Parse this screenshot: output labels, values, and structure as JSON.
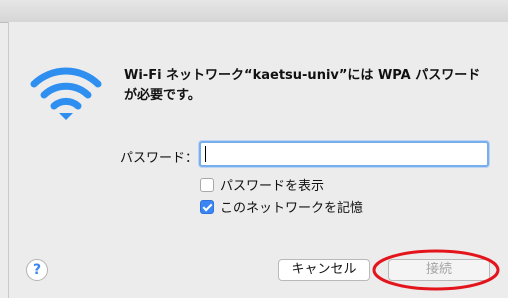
{
  "dialog": {
    "message": "Wi-Fi ネットワーク“kaetsu-univ”には WPA パスワードが必要です。",
    "password_label": "パスワード：",
    "password_value": "",
    "show_password_label": "パスワードを表示",
    "show_password_checked": false,
    "remember_label": "このネットワークを記憶",
    "remember_checked": true,
    "help_label": "?",
    "cancel_label": "キャンセル",
    "connect_label": "接続"
  },
  "colors": {
    "accent": "#3b86f4",
    "annotation_ring": "#e3141b",
    "disabled_text": "#a5a5a5"
  },
  "icons": [
    "wifi-icon",
    "checkbox-icon",
    "checkmark-icon",
    "help-icon"
  ]
}
